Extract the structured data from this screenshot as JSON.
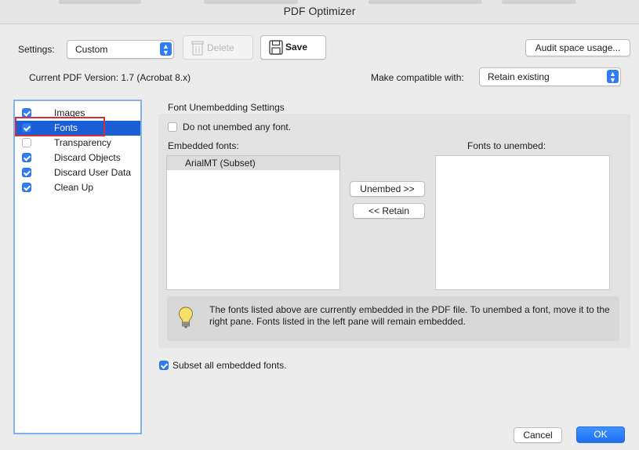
{
  "window": {
    "title": "PDF Optimizer"
  },
  "toolbar": {
    "settings_label": "Settings:",
    "settings_value": "Custom",
    "delete_label": "Delete",
    "save_label": "Save",
    "audit_label": "Audit space usage..."
  },
  "version": {
    "current_text": "Current PDF Version: 1.7 (Acrobat 8.x)",
    "compat_label": "Make compatible with:",
    "compat_value": "Retain existing"
  },
  "sidebar": {
    "items": [
      {
        "label": "Images",
        "checked": true,
        "selected": false
      },
      {
        "label": "Fonts",
        "checked": true,
        "selected": true
      },
      {
        "label": "Transparency",
        "checked": false,
        "selected": false
      },
      {
        "label": "Discard Objects",
        "checked": true,
        "selected": false
      },
      {
        "label": "Discard User Data",
        "checked": true,
        "selected": false
      },
      {
        "label": "Clean Up",
        "checked": true,
        "selected": false
      }
    ]
  },
  "fonts_panel": {
    "heading": "Font Unembedding Settings",
    "no_unembed_label": "Do not unembed any font.",
    "no_unembed_checked": false,
    "embedded_label": "Embedded fonts:",
    "embedded_fonts": [
      "ArialMT (Subset)"
    ],
    "unembed_button": "Unembed >>",
    "retain_button": "<< Retain",
    "to_unembed_label": "Fonts to unembed:",
    "info_text": "The fonts listed above are currently embedded in the PDF file. To unembed a font, move it to the right pane. Fonts listed in the left pane will remain embedded.",
    "subset_label": "Subset all embedded fonts.",
    "subset_checked": true
  },
  "footer": {
    "cancel_label": "Cancel",
    "ok_label": "OK"
  },
  "colors": {
    "accent": "#2f7cf6",
    "selection": "#1a5fd6",
    "highlight_box": "#d0303a"
  }
}
